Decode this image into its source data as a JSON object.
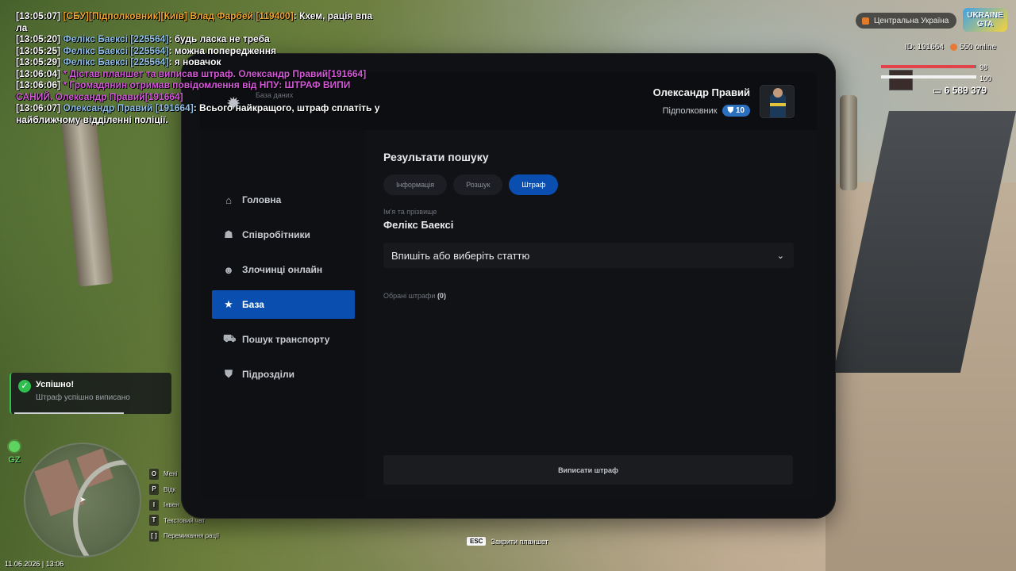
{
  "chat": [
    {
      "time": "[13:05:07]",
      "name": "[СБУ][Підполковник][Київ] Влад Фарбей [119400]",
      "color": "#f0a830",
      "text": ": Кхем, рація впа ла"
    },
    {
      "time": "[13:05:20]",
      "name": "Фелікс Баексі [225564]",
      "color": "#8fc1ea",
      "text": ": будь ласка не треба"
    },
    {
      "time": "[13:05:25]",
      "name": "Фелікс Баексі [225564]",
      "color": "#8fc1ea",
      "text": ": можна попередження"
    },
    {
      "time": "[13:05:29]",
      "name": "Фелікс Баексі [225564]",
      "color": "#8fc1ea",
      "text": ": я новачок"
    },
    {
      "time": "[13:06:04]",
      "name": "* Дістав планшет та виписав штраф. Олександр Правий[191664]",
      "color": "#d459d9",
      "text": ""
    },
    {
      "time": "[13:06:06]",
      "name": "* Громадянин отримав повідомлення від НПУ: ШТРАФ ВИПИ САНИЙ. Олександр Правий[191664]",
      "color": "#d459d9",
      "text": ""
    },
    {
      "time": "[13:06:07]",
      "name": "Олександр Правий [191664]",
      "color": "#8fc1ea",
      "text": ": Всього найкращого, штраф сплатіть у найближчому відділенні поліції."
    }
  ],
  "hud": {
    "region": "Центральна Україна",
    "logo_top": "UKRAINE",
    "logo_bottom": "GTA",
    "player_id": "ID: 191664",
    "online": "550 online",
    "health": 98,
    "armor": 100,
    "health_color": "#e2434b",
    "armor_color": "#f2f2f2",
    "money": "6 589 379"
  },
  "notification": {
    "title": "Успішно!",
    "message": "Штраф успішно виписано"
  },
  "minimap": {
    "zone": "GZ",
    "datetime": "11.06.2026 | 13:06",
    "keys": [
      {
        "key": "O",
        "label": "Мені"
      },
      {
        "key": "P",
        "label": "Відк"
      },
      {
        "key": "I",
        "label": "Інвен"
      },
      {
        "key": "T",
        "label": "Текстовий чат"
      },
      {
        "key": "[ ]",
        "label": "Перемикання рації"
      }
    ]
  },
  "esc_hint": {
    "key": "ESC",
    "label": "Закрити планшет"
  },
  "tablet": {
    "db_label": "База даних",
    "user_name": "Олександр Правий",
    "user_rank": "Підполковник",
    "user_level": "10",
    "nav": [
      {
        "label": "Головна",
        "icon": "home-icon",
        "glyph": "⌂"
      },
      {
        "label": "Співробітники",
        "icon": "users-icon",
        "glyph": "☗"
      },
      {
        "label": "Злочинці онлайн",
        "icon": "mask-icon",
        "glyph": "☻"
      },
      {
        "label": "База",
        "icon": "star-icon",
        "glyph": "★"
      },
      {
        "label": "Пошук транспорту",
        "icon": "car-icon",
        "glyph": "⛟"
      },
      {
        "label": "Підрозділи",
        "icon": "shield-icon",
        "glyph": "⛊"
      }
    ],
    "active_nav": 3,
    "results_title": "Результати пошуку",
    "tabs": [
      "Інформація",
      "Розшук",
      "Штраф"
    ],
    "active_tab": 2,
    "name_label": "Ім'я та прізвище",
    "person_name": "Фелікс Баексі",
    "select_placeholder": "Впишіть або виберіть статтю",
    "chosen_label": "Обрані штрафи",
    "chosen_count": "(0)",
    "submit_label": "Виписати штраф"
  },
  "colors": {
    "accent": "#0a4fb0",
    "success": "#2fbf4f"
  }
}
